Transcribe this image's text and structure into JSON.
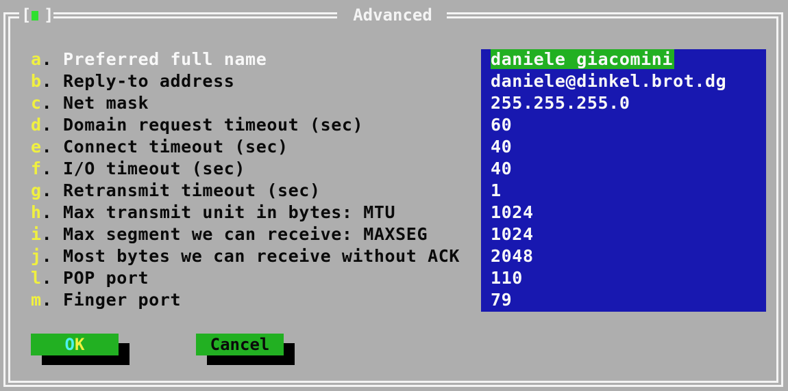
{
  "window": {
    "title": "Advanced",
    "close_box": {
      "left_bracket": "[",
      "right_bracket": "]",
      "icon": "close-square-icon",
      "color": "#2fe02f"
    }
  },
  "colors": {
    "background": "#aeaeae",
    "frame": "#f4f4f4",
    "hotkey": "#f0f040",
    "value_box": "#1818b0",
    "highlight": "#22b022",
    "button": "#22b022"
  },
  "fields": [
    {
      "key": "a",
      "label": "Preferred full name",
      "value": "daniele giacomini",
      "selected": true
    },
    {
      "key": "b",
      "label": "Reply-to address",
      "value": "daniele@dinkel.brot.dg"
    },
    {
      "key": "c",
      "label": "Net mask",
      "value": "255.255.255.0"
    },
    {
      "key": "d",
      "label": "Domain request timeout (sec)",
      "value": "60"
    },
    {
      "key": "e",
      "label": "Connect timeout (sec)",
      "value": "40"
    },
    {
      "key": "f",
      "label": "I/O timeout (sec)",
      "value": "40"
    },
    {
      "key": "g",
      "label": "Retransmit timeout (sec)",
      "value": "1"
    },
    {
      "key": "h",
      "label": "Max transmit unit in bytes: MTU",
      "value": "1024"
    },
    {
      "key": "i",
      "label": "Max segment we can receive: MAXSEG",
      "value": "1024"
    },
    {
      "key": "j",
      "label": "Most bytes we can receive without ACK",
      "value": "2048"
    },
    {
      "key": "l",
      "label": "POP port",
      "value": "110"
    },
    {
      "key": "m",
      "label": "Finger port",
      "value": "79"
    }
  ],
  "dot": ". ",
  "buttons": {
    "ok": {
      "label_first": "O",
      "label_rest": "K"
    },
    "cancel": {
      "label": "Cancel"
    }
  }
}
